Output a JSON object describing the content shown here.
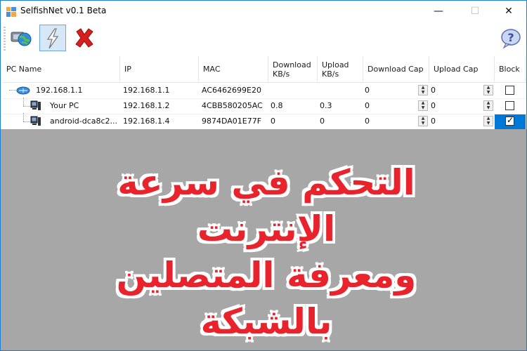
{
  "window": {
    "title": "SelfishNet v0.1 Beta",
    "controls": {
      "minimize": "—",
      "maximize": "☐",
      "close": "✕"
    }
  },
  "toolbar": {
    "buttons": [
      {
        "icon": "network-globe-icon"
      },
      {
        "icon": "lightning-icon",
        "pressed": true
      },
      {
        "icon": "red-x-icon"
      }
    ],
    "help_icon": "help-question-icon"
  },
  "grid": {
    "columns": [
      {
        "label": "PC Name"
      },
      {
        "label": "IP"
      },
      {
        "label": "MAC"
      },
      {
        "label_line1": "Download",
        "label_line2": "KB/s"
      },
      {
        "label_line1": "Upload",
        "label_line2": "KB/s"
      },
      {
        "label": "Download Cap"
      },
      {
        "label": "Upload Cap"
      },
      {
        "label": "Block"
      }
    ],
    "rows": [
      {
        "name": "192.168.1.1",
        "ip": "192.168.1.1",
        "mac": "AC6462699E20",
        "download": "",
        "upload": "",
        "download_cap": "0",
        "upload_cap": "0",
        "blocked": false,
        "kind": "router"
      },
      {
        "name": "Your PC",
        "ip": "192.168.1.2",
        "mac": "4CBB580205AC",
        "download": "0.8",
        "upload": "0.3",
        "download_cap": "0",
        "upload_cap": "0",
        "blocked": false,
        "kind": "pc"
      },
      {
        "name": "android-dca8c2...",
        "ip": "192.168.1.4",
        "mac": "9874DA01E77F",
        "download": "0",
        "upload": "0",
        "download_cap": "0",
        "upload_cap": "0",
        "blocked": true,
        "kind": "pc"
      }
    ]
  },
  "overlay": {
    "line1": "التحكم في سرعة الإنترنت",
    "line2": "ومعرفة المتصلين بالشبكة",
    "color": "#e8232c"
  },
  "colors": {
    "accent": "#0078d7",
    "background_area": "#a7a7a7"
  }
}
